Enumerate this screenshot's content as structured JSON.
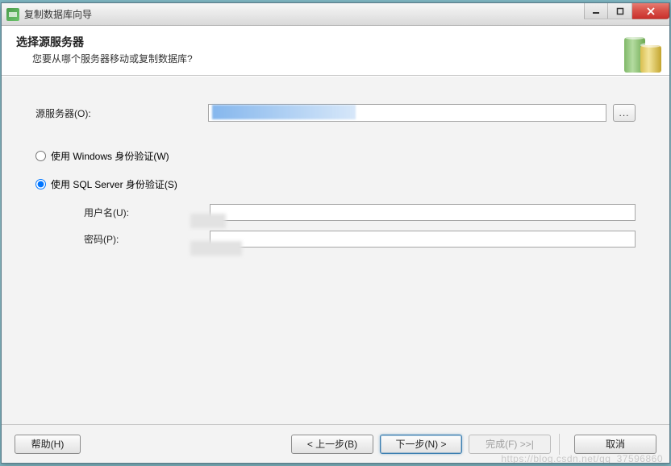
{
  "window": {
    "title": "复制数据库向导"
  },
  "header": {
    "title": "选择源服务器",
    "subtitle": "您要从哪个服务器移动或复制数据库?"
  },
  "form": {
    "source_server_label": "源服务器(O):",
    "source_server_value": "",
    "browse_label": "...",
    "auth_windows_label": "使用 Windows 身份验证(W)",
    "auth_sql_label": "使用 SQL Server 身份验证(S)",
    "auth_selected": "sql",
    "username_label": "用户名(U):",
    "username_value": "",
    "password_label": "密码(P):",
    "password_value": ""
  },
  "footer": {
    "help": "帮助(H)",
    "back": "< 上一步(B)",
    "next": "下一步(N) >",
    "finish": "完成(F) >>|",
    "cancel": "取消"
  }
}
